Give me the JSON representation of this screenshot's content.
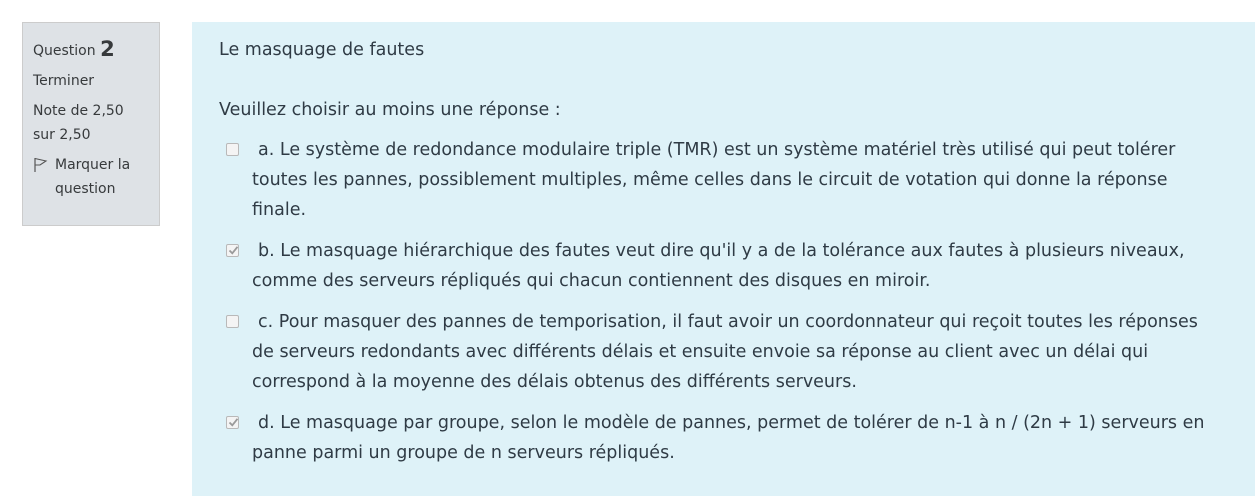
{
  "info": {
    "question_word": "Question",
    "question_number": "2",
    "state": "Terminer",
    "grade_line1": "Note de 2,50",
    "grade_line2": "sur 2,50",
    "flag_label_line1": "Marquer la",
    "flag_label_line2": "question",
    "flag_icon": "flag-outline-icon"
  },
  "question": {
    "text": "Le masquage de fautes",
    "prompt": "Veuillez choisir au moins une réponse :"
  },
  "answers": [
    {
      "letter": "a.",
      "text": "Le système de redondance modulaire triple (TMR) est un système matériel très utilisé qui peut tolérer toutes les pannes, possiblement multiples, même celles dans le circuit de votation qui donne la réponse finale.",
      "checked": false
    },
    {
      "letter": "b.",
      "text": "Le masquage hiérarchique des fautes veut dire qu'il y a de la tolérance aux fautes à plusieurs niveaux, comme des serveurs répliqués qui chacun contiennent des disques en miroir.",
      "checked": true
    },
    {
      "letter": "c.",
      "text": "Pour masquer des pannes de temporisation, il faut avoir un coordonnateur qui reçoit toutes les réponses de serveurs redondants avec différents délais et ensuite envoie sa réponse au client avec un délai qui correspond à la moyenne des délais obtenus des différents serveurs.",
      "checked": false
    },
    {
      "letter": "d.",
      "text": "Le masquage par groupe, selon le modèle de pannes, permet de tolérer de n-1 à n / (2n + 1) serveurs en panne parmi un groupe de n serveurs répliqués.",
      "checked": true
    }
  ],
  "colors": {
    "info_bg": "#dee2e6",
    "content_bg": "#def2f8",
    "text": "#2f3b45"
  }
}
